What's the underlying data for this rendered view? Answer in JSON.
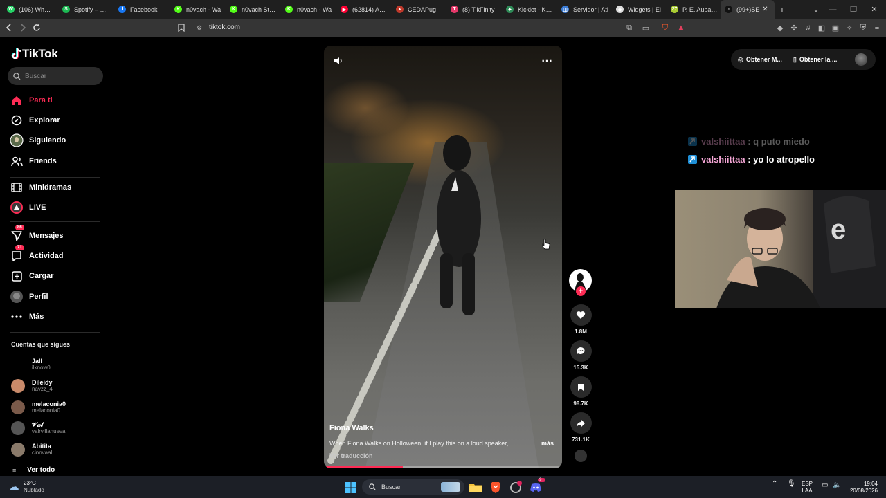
{
  "browser": {
    "tabs": [
      {
        "label": "(106) WhatsA",
        "color": "#25d366",
        "glyph": "W"
      },
      {
        "label": "Spotify – Tus",
        "color": "#1db954",
        "glyph": "S"
      },
      {
        "label": "Facebook",
        "color": "#1877f2",
        "glyph": "f"
      },
      {
        "label": "n0vach - Wa",
        "color": "#53fc18",
        "glyph": "K"
      },
      {
        "label": "n0vach Strea",
        "color": "#53fc18",
        "glyph": "K"
      },
      {
        "label": "n0vach - Wa",
        "color": "#53fc18",
        "glyph": "K"
      },
      {
        "label": "(62814) Aven",
        "color": "#ff0033",
        "glyph": "▶"
      },
      {
        "label": "CEDAPug",
        "color": "#c0392b",
        "glyph": "▲"
      },
      {
        "label": "(8) TikFinity",
        "color": "#e6396a",
        "glyph": "T"
      },
      {
        "label": "Kicklet - Kick",
        "color": "#2e8b57",
        "glyph": "✦"
      },
      {
        "label": "Servidor | Ati",
        "color": "#3a7bd5",
        "glyph": "◫"
      },
      {
        "label": "Widgets | El",
        "color": "#dddddd",
        "glyph": "◆"
      },
      {
        "label": "P. E. Aubame",
        "color": "#aacc33",
        "glyph": "27"
      },
      {
        "label": "(99+)SE",
        "color": "#111111",
        "glyph": "♪"
      }
    ],
    "new_tab": "+",
    "url": "tiktok.com"
  },
  "sidebar": {
    "logo": "TikTok",
    "search_placeholder": "Buscar",
    "nav": [
      {
        "label": "Para ti",
        "icon": "home-icon",
        "active": true,
        "badge": ""
      },
      {
        "label": "Explorar",
        "icon": "compass-icon",
        "active": false,
        "badge": ""
      },
      {
        "label": "Siguiendo",
        "icon": "following-avatar-icon",
        "active": false,
        "badge": ""
      },
      {
        "label": "Friends",
        "icon": "friends-icon",
        "active": false,
        "badge": ""
      },
      {
        "label": "Minidramas",
        "icon": "film-icon",
        "active": false,
        "badge": ""
      },
      {
        "label": "LIVE",
        "icon": "live-icon",
        "active": false,
        "badge": ""
      },
      {
        "label": "Mensajes",
        "icon": "send-icon",
        "active": false,
        "badge": "86"
      },
      {
        "label": "Actividad",
        "icon": "chat-bubble-icon",
        "active": false,
        "badge": "71"
      },
      {
        "label": "Cargar",
        "icon": "plus-square-icon",
        "active": false,
        "badge": ""
      },
      {
        "label": "Perfil",
        "icon": "profile-avatar-icon",
        "active": false,
        "badge": ""
      },
      {
        "label": "Más",
        "icon": "more-dots-icon",
        "active": false,
        "badge": ""
      }
    ],
    "following_title": "Cuentas que sigues",
    "accounts": [
      {
        "name": "Jall",
        "handle": "ilknow0",
        "color": "#000000"
      },
      {
        "name": "Dileidy",
        "handle": "navzz_4",
        "color": "#c98a6a"
      },
      {
        "name": "melaconia0",
        "handle": "melaconia0",
        "color": "#7a5a4a"
      },
      {
        "name": "𝓥𝓪𝓵",
        "handle": "valrvillanueva",
        "color": "#555555"
      },
      {
        "name": "Abitita",
        "handle": "cinnvaal",
        "color": "#8a7a6a"
      }
    ],
    "see_all": "Ver todo"
  },
  "video": {
    "title": "Fiona Walks",
    "description": "When Fiona Walks on Holloween, if I play this on a loud speaker,",
    "more": "más",
    "translate": "Ver traducción",
    "progress": 0.33
  },
  "actions": {
    "likes": "1.8M",
    "comments": "15.3K",
    "saves": "98.7K",
    "shares": "731.1K"
  },
  "topright": {
    "btn1": "Obtener M...",
    "btn2": "Obtener la ..."
  },
  "overlay_chat": [
    {
      "user": "valshiittaa",
      "sep": " : ",
      "msg": "q puto miedo",
      "faded": true
    },
    {
      "user": "valshiittaa",
      "sep": " : ",
      "msg": "yo lo atropello",
      "faded": false
    }
  ],
  "taskbar": {
    "temp": "23°C",
    "condition": "Nublado",
    "search": "Buscar",
    "lang_top": "ESP",
    "lang_bottom": "LAA",
    "time": "19:04",
    "date": "20/08/2026",
    "notif_badge": "9+"
  },
  "colors": {
    "accent": "#fe2c55",
    "kick_green": "#53fc18"
  }
}
